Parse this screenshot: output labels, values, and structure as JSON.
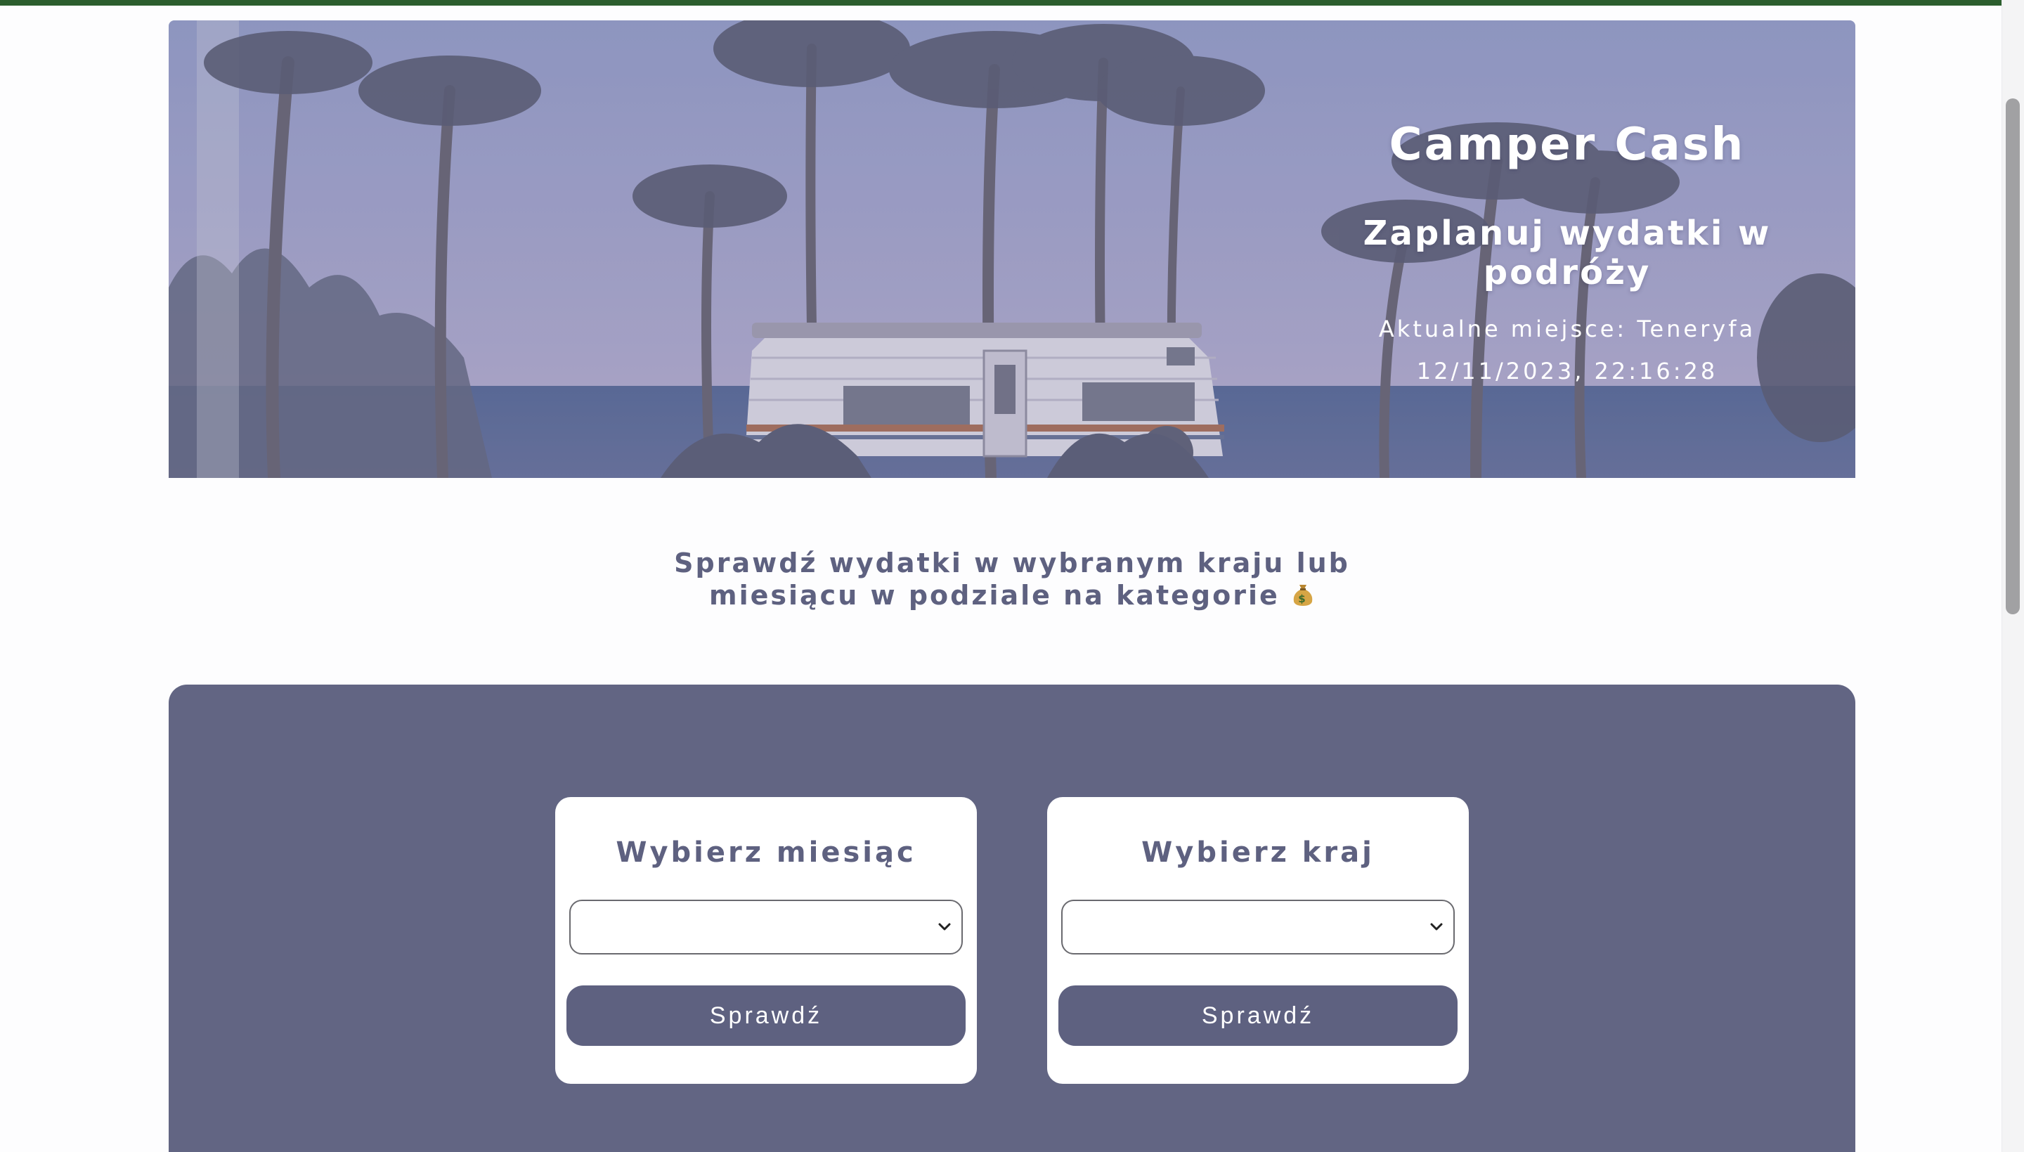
{
  "colors": {
    "accent": "#626583",
    "button": "#5e6180",
    "heading_text": "#5e6180",
    "top_bar": "#2c5e2e",
    "hero_overlay": "#8f95c0"
  },
  "hero": {
    "title": "Camper Cash",
    "subtitle": "Zaplanuj wydatki w podróży",
    "location": "Aktualne miejsce: Teneryfa",
    "datetime": "12/11/2023, 22:16:28"
  },
  "section": {
    "heading_line1": "Sprawdź wydatki w wybranym kraju lub",
    "heading_line2": "miesiącu w podziale na kategorie",
    "heading_icon": "money-bag-icon"
  },
  "month_card": {
    "label": "Wybierz miesiąc",
    "selected": "",
    "button_label": "Sprawdź"
  },
  "country_card": {
    "label": "Wybierz kraj",
    "selected": "",
    "button_label": "Sprawdź"
  }
}
